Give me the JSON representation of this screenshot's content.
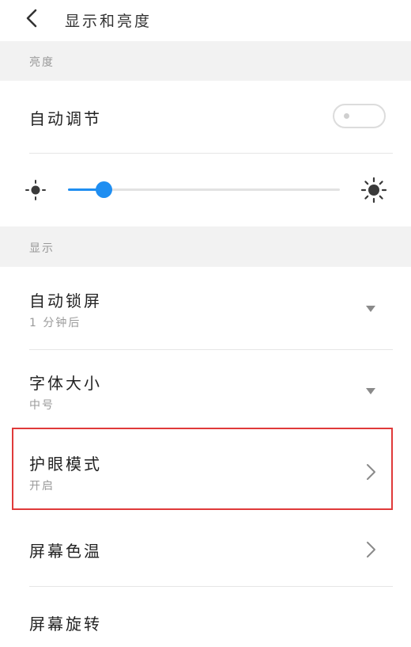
{
  "header": {
    "title": "显示和亮度",
    "back_icon": "chevron-left-icon"
  },
  "brightness_section": {
    "label": "亮度",
    "auto_adjust_label": "自动调节",
    "auto_adjust_on": false,
    "level": 0.13,
    "low_icon": "sun-small-icon",
    "high_icon": "sun-large-icon",
    "accent_color": "#1f8ef1"
  },
  "display_section": {
    "label": "显示",
    "items": [
      {
        "title": "自动锁屏",
        "value": "1 分钟后",
        "icon": "dropdown-arrow-icon"
      },
      {
        "title": "字体大小",
        "value": "中号",
        "icon": "dropdown-arrow-icon"
      },
      {
        "title": "护眼模式",
        "value": "开启",
        "icon": "chevron-right-icon",
        "highlighted": true
      },
      {
        "title": "屏幕色温",
        "icon": "chevron-right-icon"
      },
      {
        "title": "屏幕旋转"
      }
    ]
  },
  "highlight_color": "#e03a3a"
}
